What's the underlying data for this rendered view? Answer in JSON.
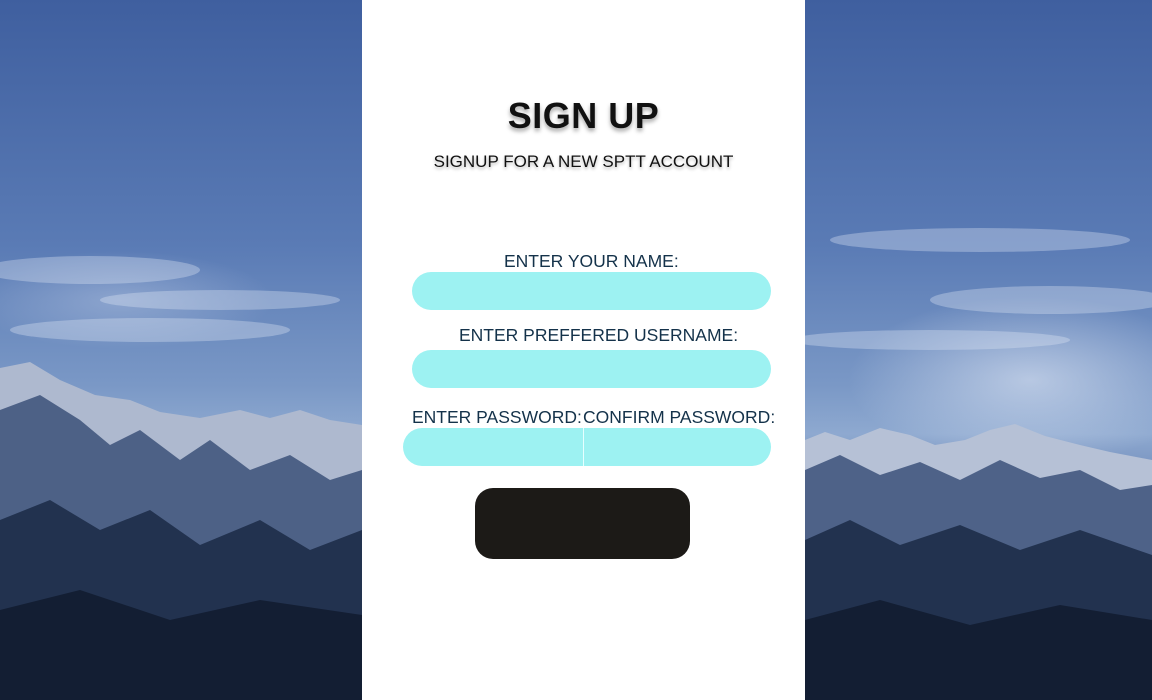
{
  "header": {
    "title": "SIGN UP",
    "subtitle": "SIGNUP FOR A NEW SPTT ACCOUNT"
  },
  "form": {
    "name_label": "ENTER YOUR NAME:",
    "name_value": "",
    "username_label": "ENTER PREFFERED USERNAME:",
    "username_value": "",
    "password_label": "ENTER PASSWORD:",
    "password_value": "",
    "confirm_label": "CONFIRM PASSWORD:",
    "confirm_value": "",
    "submit_label": ""
  },
  "colors": {
    "input_fill": "#9df2f2",
    "button_fill": "#1c1a17",
    "panel": "#ffffff",
    "label_text": "#14324a"
  }
}
